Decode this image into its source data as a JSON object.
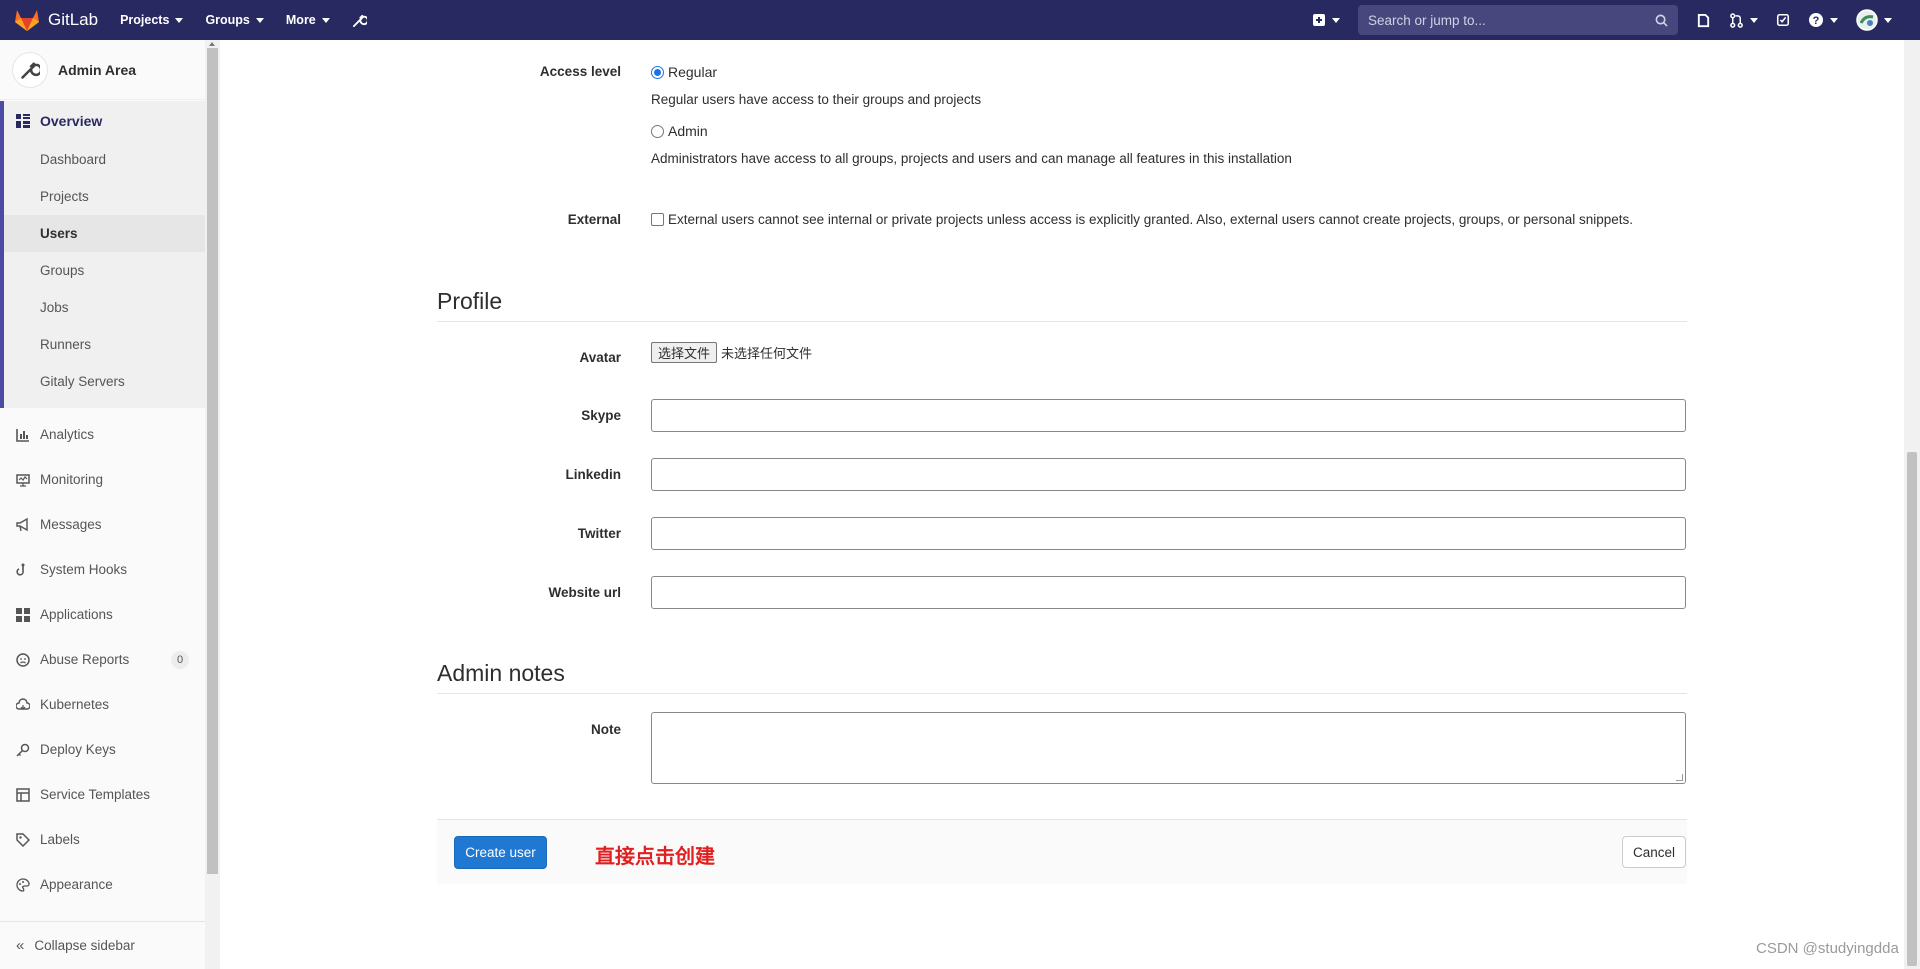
{
  "navbar": {
    "brand": "GitLab",
    "menu": [
      {
        "label": "Projects"
      },
      {
        "label": "Groups"
      },
      {
        "label": "More"
      }
    ],
    "search_placeholder": "Search or jump to...",
    "bg_color": "#292961"
  },
  "sidebar": {
    "context_title": "Admin Area",
    "overview": {
      "label": "Overview",
      "items": [
        "Dashboard",
        "Projects",
        "Users",
        "Groups",
        "Jobs",
        "Runners",
        "Gitaly Servers"
      ],
      "active_item": "Users"
    },
    "items": [
      {
        "label": "Analytics",
        "icon": "chart-icon"
      },
      {
        "label": "Monitoring",
        "icon": "monitor-icon"
      },
      {
        "label": "Messages",
        "icon": "bullhorn-icon"
      },
      {
        "label": "System Hooks",
        "icon": "hook-icon"
      },
      {
        "label": "Applications",
        "icon": "applications-icon"
      },
      {
        "label": "Abuse Reports",
        "icon": "abuse-icon",
        "badge": "0"
      },
      {
        "label": "Kubernetes",
        "icon": "cloud-icon"
      },
      {
        "label": "Deploy Keys",
        "icon": "key-icon"
      },
      {
        "label": "Service Templates",
        "icon": "template-icon"
      },
      {
        "label": "Labels",
        "icon": "label-icon"
      },
      {
        "label": "Appearance",
        "icon": "palette-icon"
      }
    ],
    "collapse_label": "Collapse sidebar"
  },
  "form": {
    "access_level": {
      "label": "Access level",
      "regular_label": "Regular",
      "regular_help": "Regular users have access to their groups and projects",
      "admin_label": "Admin",
      "admin_help": "Administrators have access to all groups, projects and users and can manage all features in this installation",
      "selected": "Regular"
    },
    "external": {
      "label": "External",
      "help": "External users cannot see internal or private projects unless access is explicitly granted. Also, external users cannot create projects, groups, or personal snippets.",
      "checked": false
    },
    "profile": {
      "title": "Profile",
      "avatar_label": "Avatar",
      "file_button": "选择文件",
      "file_status": "未选择任何文件",
      "skype_label": "Skype",
      "linkedin_label": "Linkedin",
      "twitter_label": "Twitter",
      "website_label": "Website url",
      "skype_value": "",
      "linkedin_value": "",
      "twitter_value": "",
      "website_value": ""
    },
    "admin_notes": {
      "title": "Admin notes",
      "note_label": "Note",
      "note_value": ""
    },
    "actions": {
      "create_label": "Create user",
      "cancel_label": "Cancel",
      "annotation": "直接点击创建"
    }
  },
  "watermark": "CSDN @studyingdda"
}
